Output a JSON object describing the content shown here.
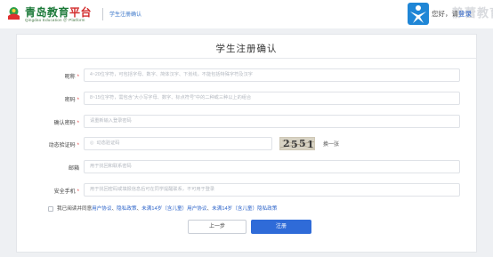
{
  "header": {
    "brand_title_part1": "青岛教育",
    "brand_title_part2": "平台",
    "brand_subtitle": "Qingdao Education ＠ Platform",
    "page_name": "学生注册确认",
    "right_login_prefix": "您好，请",
    "right_login_link": "登录",
    "right_watermark": "静蕾教育"
  },
  "form": {
    "title": "学生注册确认",
    "fields": [
      {
        "label": "昵称",
        "required": true,
        "placeholder": "4~20位字符，可包括字母、数字、简体汉字、下划线，不能包括特殊字符及汉字"
      },
      {
        "label": "密码",
        "required": true,
        "placeholder": "8~15位字符，需包含“大小写字母、数字、标点符号”中的二种或三种以上的组合"
      },
      {
        "label": "确认密码",
        "required": true,
        "placeholder": "请重新输入登录密码"
      },
      {
        "label": "动态验证码",
        "required": true,
        "placeholder": "动态验证码"
      },
      {
        "label": "邮箱",
        "required": false,
        "placeholder": "用于找回和联系密码"
      },
      {
        "label": "安全手机",
        "required": true,
        "placeholder": "用于找回密码或填报信息后可在同学提醒联系，不可用于登录"
      }
    ],
    "captcha_text": [
      "2",
      "5",
      "5",
      "1"
    ],
    "captcha_refresh": "换一张",
    "agree_text": "我已阅读并同意",
    "agree_links": [
      "用户协议",
      "隐私政策",
      "未满14岁（含儿童）用户协议",
      "未满14岁（含儿童）隐私政策"
    ],
    "agree_separator": "、",
    "btn_prev": "上一步",
    "btn_register": "注册"
  },
  "colors": {
    "primary": "#2f6bd8",
    "link": "#2a62c9",
    "required": "#e04040",
    "brand_green": "#1d7a3a",
    "brand_red": "#d22a2a"
  }
}
